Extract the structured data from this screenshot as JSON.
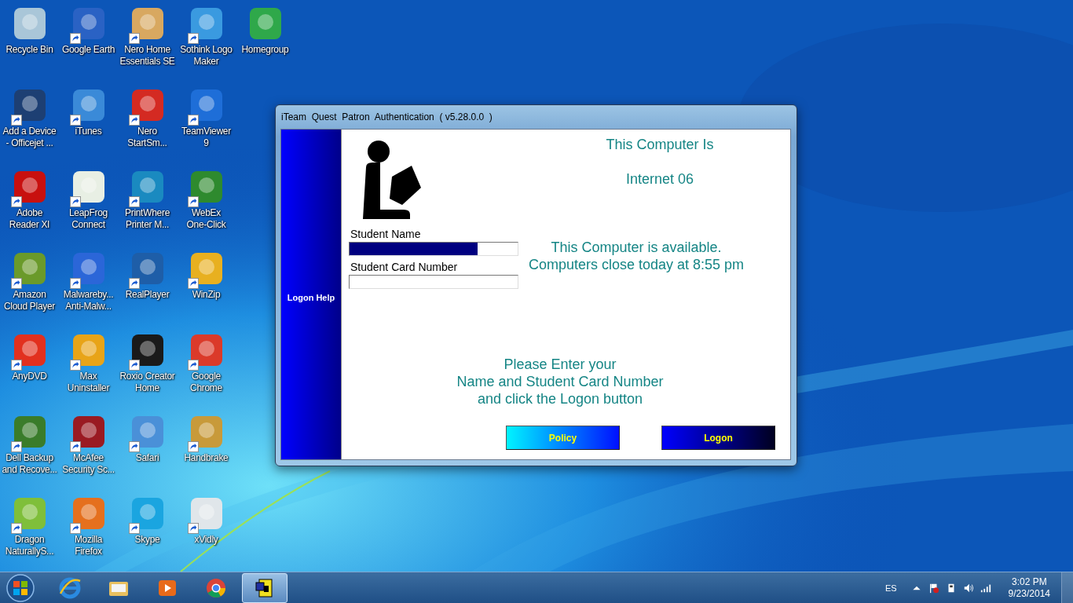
{
  "desktop_icons": [
    {
      "lines": [
        "Recycle Bin"
      ],
      "color": "#a9c6d8",
      "shortcut": false
    },
    {
      "lines": [
        "Add a Device",
        "- Officejet ..."
      ],
      "color": "#1d3f73",
      "shortcut": true
    },
    {
      "lines": [
        "Adobe",
        "Reader XI"
      ],
      "color": "#c8100f",
      "shortcut": true
    },
    {
      "lines": [
        "Amazon",
        "Cloud Player"
      ],
      "color": "#6a9a2a",
      "shortcut": true
    },
    {
      "lines": [
        "AnyDVD"
      ],
      "color": "#e2301e",
      "shortcut": true
    },
    {
      "lines": [
        "Dell Backup",
        "and Recove..."
      ],
      "color": "#3a7c2a",
      "shortcut": true
    },
    {
      "lines": [
        "Dragon",
        "NaturallyS..."
      ],
      "color": "#7fbf3a",
      "shortcut": true
    },
    {
      "lines": [
        "Google Earth"
      ],
      "color": "#2a62c4",
      "shortcut": true
    },
    {
      "lines": [
        "iTunes"
      ],
      "color": "#3a8ad8",
      "shortcut": true
    },
    {
      "lines": [
        "LeapFrog",
        "Connect"
      ],
      "color": "#e8efe4",
      "shortcut": true
    },
    {
      "lines": [
        "Malwareby...",
        "Anti-Malw..."
      ],
      "color": "#2b66d8",
      "shortcut": true
    },
    {
      "lines": [
        "Max",
        "Uninstaller"
      ],
      "color": "#e8a418",
      "shortcut": true
    },
    {
      "lines": [
        "McAfee",
        "Security Sc..."
      ],
      "color": "#9a1a22",
      "shortcut": true
    },
    {
      "lines": [
        "Mozilla",
        "Firefox"
      ],
      "color": "#e5701e",
      "shortcut": true
    },
    {
      "lines": [
        "Nero Home",
        "Essentials SE"
      ],
      "color": "#d8a860",
      "shortcut": true
    },
    {
      "lines": [
        "Nero",
        "StartSm..."
      ],
      "color": "#d42a22",
      "shortcut": true
    },
    {
      "lines": [
        "PrintWhere",
        "Printer M..."
      ],
      "color": "#1a8ac0",
      "shortcut": true
    },
    {
      "lines": [
        "RealPlayer"
      ],
      "color": "#1e5ea8",
      "shortcut": true
    },
    {
      "lines": [
        "Roxio Creator",
        "Home"
      ],
      "color": "#1a1a1a",
      "shortcut": true
    },
    {
      "lines": [
        "Safari"
      ],
      "color": "#4a90d8",
      "shortcut": true
    },
    {
      "lines": [
        "Skype"
      ],
      "color": "#1aa5e0",
      "shortcut": true
    },
    {
      "lines": [
        "Sothink Logo",
        "Maker"
      ],
      "color": "#3a9ae0",
      "shortcut": true
    },
    {
      "lines": [
        "TeamViewer",
        "9"
      ],
      "color": "#1e6ed8",
      "shortcut": true
    },
    {
      "lines": [
        "WebEx",
        "One-Click"
      ],
      "color": "#2e8a2e",
      "shortcut": true
    },
    {
      "lines": [
        "WinZip"
      ],
      "color": "#e8b020",
      "shortcut": true
    },
    {
      "lines": [
        "Google",
        "Chrome"
      ],
      "color": "#db3a2a",
      "shortcut": true
    },
    {
      "lines": [
        "Handbrake"
      ],
      "color": "#c89a3a",
      "shortcut": true
    },
    {
      "lines": [
        "xVidly"
      ],
      "color": "#e0e6ea",
      "shortcut": true
    },
    {
      "lines": [
        "Homegroup"
      ],
      "color": "#2fa84a",
      "shortcut": false
    }
  ],
  "window": {
    "title": "iTeam  Quest  Patron  Authentication  ( v5.28.0.0  )",
    "sidebar": {
      "label": "Logon Help"
    },
    "student_name": {
      "label": "Student Name",
      "highlighted": true
    },
    "student_card": {
      "label": "Student Card Number",
      "highlighted": false
    },
    "computer_heading": "This Computer Is",
    "computer_name": "Internet 06",
    "status_lines": [
      "This Computer is available.",
      "Computers close today at 8:55 pm"
    ],
    "instructions": [
      "Please Enter your",
      "Name and Student Card Number",
      "and click the Logon button"
    ],
    "buttons": [
      {
        "label": "Policy",
        "kind": "policy"
      },
      {
        "label": "Logon",
        "kind": "logon"
      }
    ]
  },
  "taskbar": {
    "items": [
      {
        "kind": "ie",
        "selected": false
      },
      {
        "kind": "folder",
        "selected": false
      },
      {
        "kind": "media",
        "selected": false
      },
      {
        "kind": "chrome",
        "selected": false
      },
      {
        "kind": "iteam",
        "selected": true
      }
    ],
    "language": "ES",
    "time": "3:02 PM",
    "date": "9/23/2014"
  }
}
